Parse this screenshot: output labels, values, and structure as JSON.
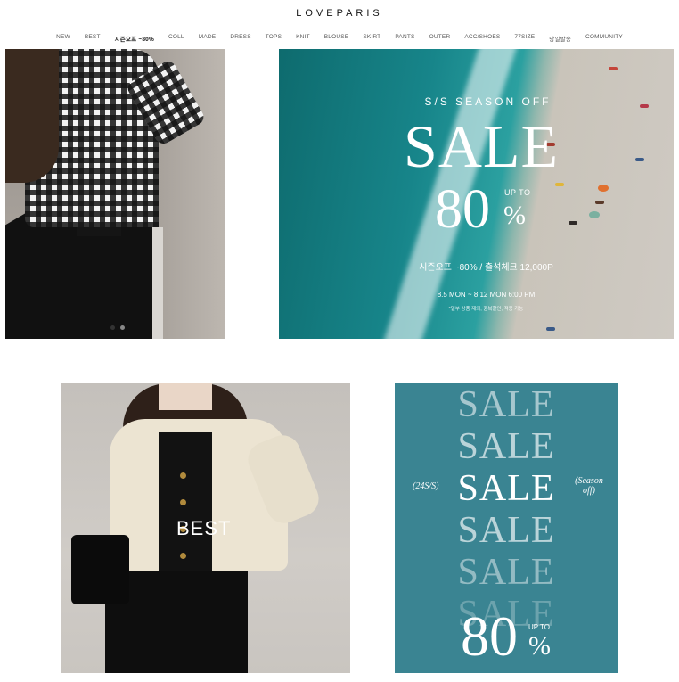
{
  "header": {
    "logo": "LOVEPARIS",
    "nav": [
      {
        "label": "NEW",
        "bold": false
      },
      {
        "label": "BEST",
        "bold": false
      },
      {
        "label": "시즌오프 ~80%",
        "bold": true
      },
      {
        "label": "COLL",
        "bold": false
      },
      {
        "label": "MADE",
        "bold": false
      },
      {
        "label": "DRESS",
        "bold": false
      },
      {
        "label": "TOPS",
        "bold": false
      },
      {
        "label": "KNIT",
        "bold": false
      },
      {
        "label": "BLOUSE",
        "bold": false
      },
      {
        "label": "SKIRT",
        "bold": false
      },
      {
        "label": "PANTS",
        "bold": false
      },
      {
        "label": "OUTER",
        "bold": false
      },
      {
        "label": "ACC/SHOES",
        "bold": false
      },
      {
        "label": "77SIZE",
        "bold": false
      },
      {
        "label": "당일발송",
        "bold": false
      },
      {
        "label": "COMMUNITY",
        "bold": false
      }
    ]
  },
  "hero": {
    "slider_dots": 2,
    "active_dot": 0,
    "banner": {
      "season": "S/S SEASON OFF",
      "sale": "SALE",
      "upto": "UP TO",
      "percent_value": "80",
      "percent_sign": "%",
      "line1": "시즌오프 ~80% / 출석체크 12,000P",
      "line2": "8.5 MON ~ 8.12 MON 6:00 PM",
      "line3": "*일부 상품 제외, 중복할인, 적용 가능"
    }
  },
  "best_card": {
    "label": "BEST"
  },
  "sale_card": {
    "rows": [
      "SALE",
      "SALE",
      "SALE",
      "SALE",
      "SALE",
      "SALE"
    ],
    "side_left": "(24S/S)",
    "side_right": "(Season off)",
    "upto": "UP TO",
    "percent_value": "80",
    "percent_sign": "%"
  },
  "colors": {
    "sale_card_bg": "#3a8492",
    "banner_sea": "#17858a",
    "text_white": "#ffffff"
  }
}
